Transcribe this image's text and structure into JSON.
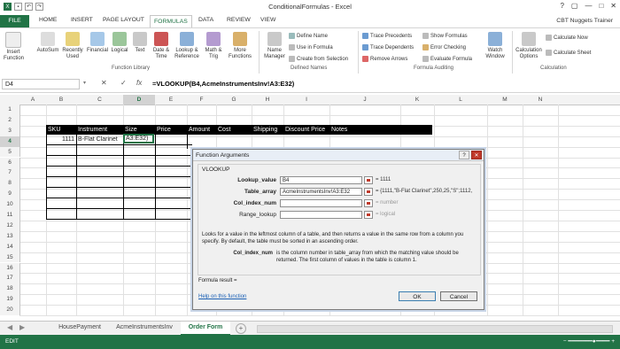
{
  "window": {
    "title": "ConditionalFormulas - Excel",
    "qat": [
      "save-icon",
      "undo-icon",
      "redo-icon"
    ],
    "controls": [
      "?",
      "▢",
      "—",
      "□",
      "✕"
    ]
  },
  "tabs": [
    "FILE",
    "HOME",
    "INSERT",
    "PAGE LAYOUT",
    "FORMULAS",
    "DATA",
    "REVIEW",
    "VIEW"
  ],
  "user": "CBT Nuggets Trainer",
  "ribbon": {
    "function_library": {
      "label": "Function Library",
      "buttons": [
        "Insert Function",
        "AutoSum",
        "Recently Used",
        "Financial",
        "Logical",
        "Text",
        "Date & Time",
        "Lookup & Reference",
        "Math & Trig",
        "More Functions"
      ]
    },
    "defined_names": {
      "label": "Defined Names",
      "name_manager": "Name Manager",
      "items": [
        "Define Name",
        "Use in Formula",
        "Create from Selection"
      ]
    },
    "formula_auditing": {
      "label": "Formula Auditing",
      "items": [
        "Trace Precedents",
        "Trace Dependents",
        "Remove Arrows",
        "Show Formulas",
        "Error Checking",
        "Evaluate Formula"
      ],
      "watch": "Watch Window"
    },
    "calculation": {
      "label": "Calculation",
      "options": "Calculation Options",
      "items": [
        "Calculate Now",
        "Calculate Sheet"
      ]
    }
  },
  "formula_bar": {
    "name_box": "D4",
    "cancel": "✕",
    "enter": "✓",
    "fx": "fx",
    "formula": "=VLOOKUP(B4,AcmeInstrumentsInv!A3:E32)"
  },
  "columns": [
    "A",
    "B",
    "C",
    "D",
    "E",
    "F",
    "G",
    "H",
    "I",
    "J",
    "K",
    "L",
    "M",
    "N"
  ],
  "rows": [
    "1",
    "2",
    "3",
    "4",
    "5",
    "6",
    "7",
    "8",
    "9",
    "10",
    "11",
    "12",
    "13",
    "14",
    "15",
    "16",
    "17",
    "18",
    "19",
    "20"
  ],
  "table": {
    "headers": [
      "SKU",
      "Instrument",
      "Size",
      "Price",
      "Amount",
      "Cost",
      "Shipping",
      "Discount Price",
      "Notes"
    ],
    "row4": {
      "sku": "1111",
      "instrument": "B-Flat Clarinet",
      "size": "A3:E32)"
    }
  },
  "dialog": {
    "title": "Function Arguments",
    "function_name": "VLOOKUP",
    "args": [
      {
        "label": "Lookup_value",
        "value": "B4",
        "result": "= 1111"
      },
      {
        "label": "Table_array",
        "value": "AcmeInstrumentsInv!A3:E32",
        "result": "= {1111,\"B-Flat Clarinet\",250,25,\"S\";1112,"
      },
      {
        "label": "Col_index_num",
        "value": "",
        "result": "= number"
      },
      {
        "label": "Range_lookup",
        "value": "",
        "result": "= logical"
      }
    ],
    "description": "Looks for a value in the leftmost column of a table, and then returns a value in the same row from a column you specify. By default, the table must be sorted in an ascending order.",
    "arg_desc_label": "Col_index_num",
    "arg_desc": "is the column number in table_array from which the matching value should be returned. The first column of values in the table is column 1.",
    "formula_result": "Formula result =",
    "help": "Help on this function",
    "ok": "OK",
    "cancel": "Cancel"
  },
  "sheet_tabs": [
    "HousePayment",
    "AcmeInstrumentsInv",
    "Order Form"
  ],
  "status": "EDIT"
}
